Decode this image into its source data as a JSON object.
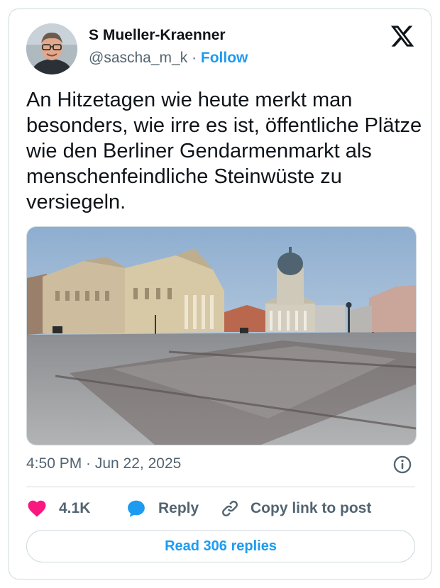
{
  "author": {
    "name": "S Mueller-Kraenner",
    "handle": "@sascha_m_k",
    "separator": "·",
    "follow_label": "Follow"
  },
  "tweet": {
    "text": "An Hitzetagen wie heute merkt man besonders, wie irre es ist, öffentliche Plätze wie den Berliner Gendarmenmarkt als menschenfeindliche Steinwüste zu versiegeln.",
    "timestamp": "4:50 PM · Jun 22, 2025"
  },
  "actions": {
    "like_count": "4.1K",
    "reply_label": "Reply",
    "copy_link_label": "Copy link to post"
  },
  "read_replies_label": "Read 306 replies",
  "icons": [
    "x-logo-icon",
    "info-icon",
    "heart-icon",
    "reply-bubble-icon",
    "link-icon"
  ],
  "colors": {
    "accent": "#1d9bf0",
    "like": "#f91880",
    "text": "#0f1419",
    "muted": "#536471",
    "border": "#cfd9de"
  }
}
